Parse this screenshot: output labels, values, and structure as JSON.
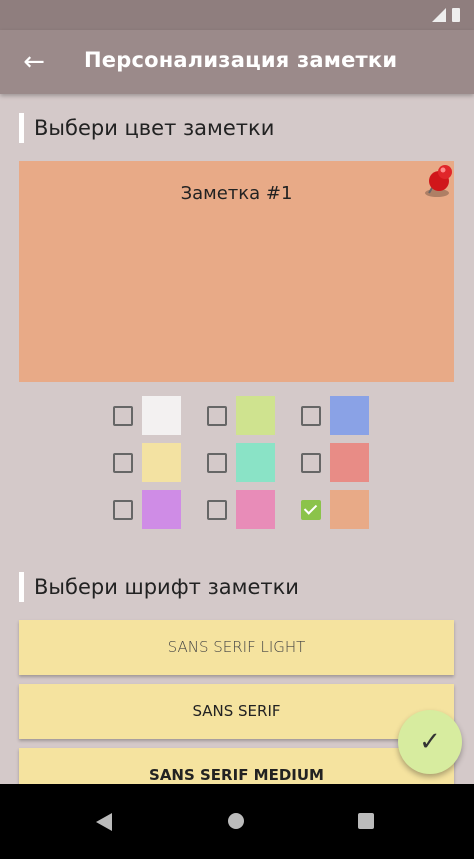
{
  "app_bar": {
    "title": "Персонализация заметки",
    "back_icon": "arrow-back-icon"
  },
  "color_section": {
    "title": "Выбери цвет заметки"
  },
  "note_preview": {
    "title": "Заметка #1",
    "color": "#e8aa87",
    "pin_icon": "red-pushpin-icon"
  },
  "swatches": [
    {
      "color": "#f3f1f1",
      "checked": false
    },
    {
      "color": "#cfe38f",
      "checked": false
    },
    {
      "color": "#8aa2e6",
      "checked": false
    },
    {
      "color": "#f3e2a2",
      "checked": false
    },
    {
      "color": "#8ae3c6",
      "checked": false
    },
    {
      "color": "#e88c86",
      "checked": false
    },
    {
      "color": "#cf8ce6",
      "checked": false
    },
    {
      "color": "#e88cb8",
      "checked": false
    },
    {
      "color": "#e8aa87",
      "checked": true
    }
  ],
  "font_section": {
    "title": "Выбери шрифт заметки"
  },
  "fonts": [
    {
      "label": "SANS SERIF LIGHT"
    },
    {
      "label": "SANS SERIF"
    },
    {
      "label": "SANS SERIF MEDIUM"
    }
  ],
  "fab": {
    "icon": "check-icon"
  },
  "colors": {
    "app_bar": "#9b8a8a",
    "background": "#d4c9c9",
    "font_button": "#f5e39f",
    "fab": "#d7ec9f"
  }
}
